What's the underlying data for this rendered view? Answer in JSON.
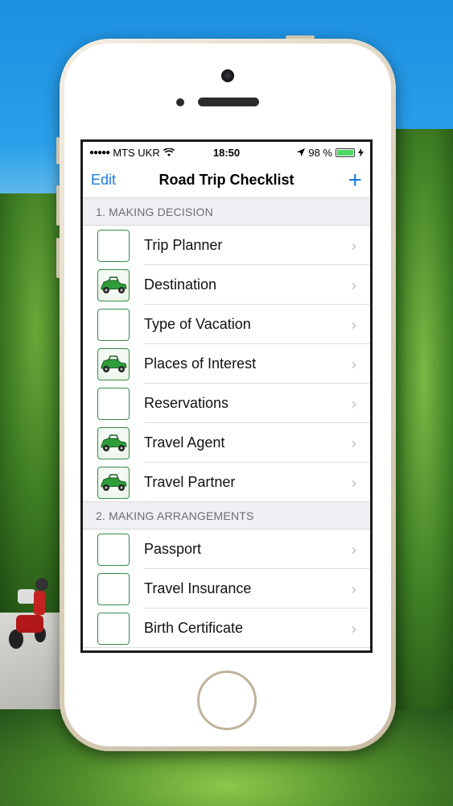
{
  "status_bar": {
    "carrier": "MTS UKR",
    "time": "18:50",
    "battery": "98 %"
  },
  "navbar": {
    "edit_label": "Edit",
    "title": "Road Trip Checklist",
    "add_label": "+"
  },
  "sections": [
    {
      "header": "1. MAKING DECISION",
      "items": [
        {
          "label": "Trip Planner",
          "checked": false
        },
        {
          "label": "Destination",
          "checked": true
        },
        {
          "label": "Type of Vacation",
          "checked": false
        },
        {
          "label": "Places of Interest",
          "checked": true
        },
        {
          "label": "Reservations",
          "checked": false
        },
        {
          "label": "Travel Agent",
          "checked": true
        },
        {
          "label": "Travel Partner",
          "checked": true
        }
      ]
    },
    {
      "header": "2. MAKING ARRANGEMENTS",
      "items": [
        {
          "label": "Passport",
          "checked": false
        },
        {
          "label": "Travel Insurance",
          "checked": false
        },
        {
          "label": "Birth Certificate",
          "checked": false
        }
      ]
    }
  ],
  "colors": {
    "accent": "#1a7ee0",
    "battery": "#4cd964",
    "checkbox_border": "#3a8a4a"
  },
  "icons": {
    "checked": "green-car-icon",
    "chevron": "chevron-right-icon"
  }
}
